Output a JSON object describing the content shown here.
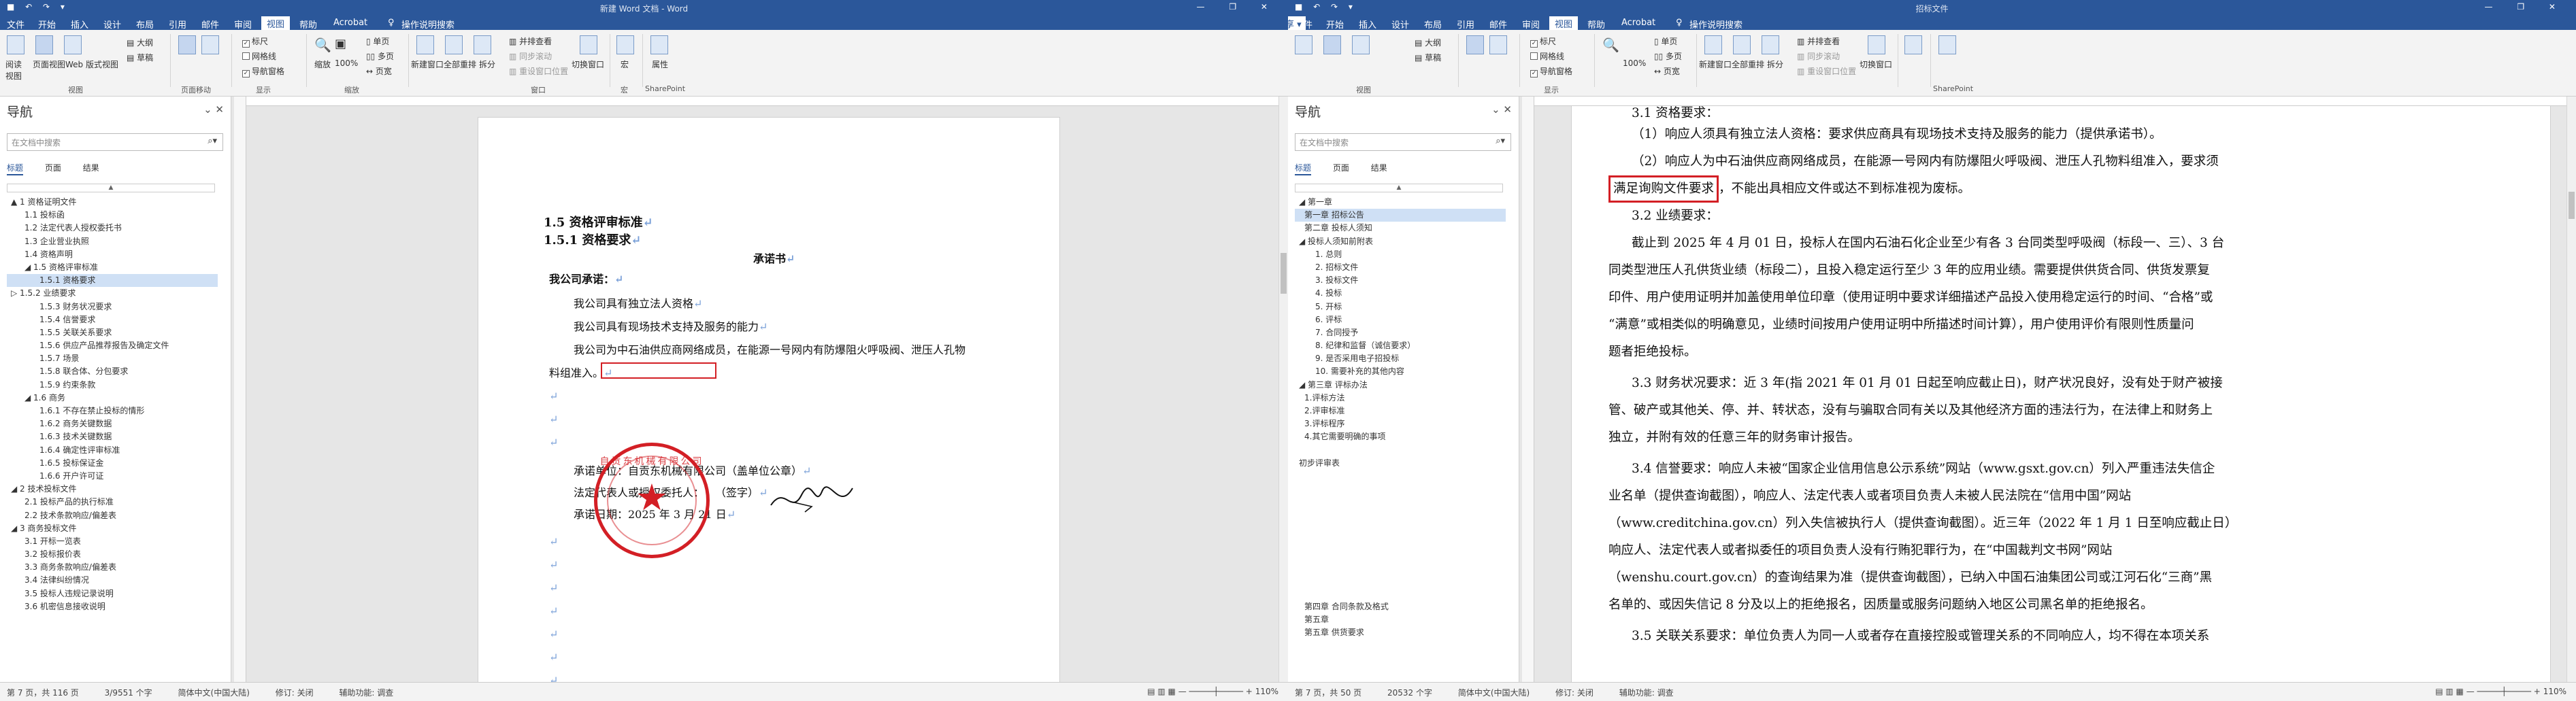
{
  "left": {
    "title": "新建 Word 文档 - Word",
    "tabs": [
      "文件",
      "开始",
      "插入",
      "设计",
      "布局",
      "引用",
      "邮件",
      "审阅",
      "视图",
      "帮助",
      "Acrobat"
    ],
    "active_tab": "视图",
    "tell_me": "操作说明搜索",
    "ribbon": {
      "views_group": [
        "阅读视图",
        "页面视图",
        "Web 版式视图"
      ],
      "outline": [
        "大纲",
        "草稿"
      ],
      "views_label": "视图",
      "page_move": "页面移动",
      "show": [
        "标尺",
        "网格线",
        "导航窗格"
      ],
      "show_label": "显示",
      "zoom_items": [
        "缩放",
        "100%"
      ],
      "pages": [
        "单页",
        "多页",
        "页宽"
      ],
      "zoom_label": "缩放",
      "window": [
        "新建窗口",
        "全部重排",
        "拆分"
      ],
      "window_small": [
        "并排查看",
        "同步滚动",
        "重设窗口位置"
      ],
      "switch": "切换窗口",
      "window_label": "窗口",
      "macro": "宏",
      "macro_label": "宏",
      "props": "属性",
      "sharepoint": "SharePoint"
    },
    "nav": {
      "title": "导航",
      "search_placeholder": "在文档中搜索",
      "tabs": [
        "标题",
        "页面",
        "结果"
      ],
      "items": [
        "▲ 1 资格证明文件",
        "1.1 投标函",
        "1.2 法定代表人授权委托书",
        "1.3 企业营业执照",
        "1.4 资格声明",
        "◢ 1.5 资格评审标准",
        "1.5.1 资格要求",
        "▷ 1.5.2 业绩要求",
        "1.5.3 财务状况要求",
        "1.5.4 信誉要求",
        "1.5.5 关联关系要求",
        "1.5.6 供应产品推荐报告及确定文件",
        "1.5.7 场景",
        "1.5.8 联合体、分包要求",
        "1.5.9 约束条款",
        "◢ 1.6 商务",
        "1.6.1 不存在禁止投标的情形",
        "1.6.2 商务关键数据",
        "1.6.3 技术关键数据",
        "1.6.4 确定性评审标准",
        "1.6.5 投标保证金",
        "1.6.6 开户许可证",
        "◢ 2 技术投标文件",
        "2.1 投标产品的执行标准",
        "2.2 技术条款响应/偏差表",
        "◢ 3 商务投标文件",
        "3.1 开标一览表",
        "3.2 投标报价表",
        "3.3 商务条款响应/偏差表",
        "3.4 法律纠纷情况",
        "3.5 投标人违规记录说明",
        "3.6 机密信息接收说明"
      ],
      "selected": 6
    },
    "doc": {
      "h1": "1.5 资格评审标准",
      "h2": "1.5.1 资格要求",
      "center_title": "承诺书",
      "lines": [
        "我公司承诺：",
        "我公司具有独立法人资格",
        "我公司具有现场技术支持及服务的能力",
        "我公司为中石油供应商网络成员，在能源一号网内有防爆阻火呼吸阀、泄压人孔物",
        "料组准入。"
      ],
      "sign": [
        "承诺单位：自贡东机械有限公司（盖单位公章）",
        "法定代表人或授权委托人：　　（签字）",
        "承诺日期：2025 年 3 月 21 日"
      ],
      "stamp_text": "自贡东机械有限公司"
    },
    "status": [
      "第 7 页，共 116 页",
      "3/9551 个字",
      "简体中文(中国大陆)",
      "修订: 关闭",
      "辅助功能: 调查"
    ],
    "zoom": "110%"
  },
  "right": {
    "title": "招标文件",
    "tabs": [
      "文件",
      "开始",
      "插入",
      "设计",
      "布局",
      "引用",
      "邮件",
      "审阅",
      "视图",
      "帮助",
      "Acrobat"
    ],
    "active_tab": "视图",
    "tell_me": "操作说明搜索",
    "share": "共享",
    "nav": {
      "title": "导航",
      "search_placeholder": "在文档中搜索",
      "tabs": [
        "标题",
        "页面",
        "结果"
      ],
      "items": [
        "◢ 第一章",
        "第一章 招标公告",
        "第二章 投标人须知",
        "◢ 投标人须知前附表",
        "1. 总则",
        "2. 招标文件",
        "3. 投标文件",
        "4. 投标",
        "5. 开标",
        "6. 评标",
        "7. 合同授予",
        "8. 纪律和监督（诚信要求）",
        "9. 是否采用电子招投标",
        "10. 需要补充的其他内容",
        "◢ 第三章 评标办法",
        "1.评标方法",
        "2.评审标准",
        "3.评标程序",
        "4.其它需要明确的事项",
        "",
        "初步评审表",
        "",
        "",
        "",
        "",
        "",
        "",
        "",
        "",
        "",
        "",
        "第四章 合同条款及格式",
        "第五章",
        "第五章 供货要求"
      ],
      "selected": 1
    },
    "doc": {
      "p0": "3.1 资格要求：",
      "p1": "（1）响应人须具有独立法人资格：要求供应商具有现场技术支持及服务的能力（提供承诺书）。",
      "p2a": "（2）响应人为中石油供应商网络成员，在能源一号网内有防爆阻火呼吸阀、泄压人孔物料组准入，要求须",
      "p2b": "满足询购文件要求",
      "p2c": "，不能出具相应文件或达不到标准视为废标。",
      "p3": "3.2 业绩要求：",
      "p4": [
        "截止到 2025 年 4 月 01 日，投标人在国内石油石化企业至少有各 3 台同类型呼吸阀（标段一、三）、3 台",
        "同类型泄压人孔供货业绩（标段二），且投入稳定运行至少 3 年的应用业绩。需要提供供货合同、供货发票复",
        "印件、用户使用证明并加盖使用单位印章（使用证明中要求详细描述产品投入使用稳定运行的时间、“合格”或",
        "“满意”或相类似的明确意见，业绩时间按用户使用证明中所描述时间计算），用户使用评价有限则性质量问",
        "题者拒绝投标。"
      ],
      "p5": [
        "3.3 财务状况要求：近 3 年(指 2021 年 01 月 01 日起至响应截止日)，财产状况良好，没有处于财产被接",
        "管、破产或其他关、停、并、转状态，没有与骗取合同有关以及其他经济方面的违法行为，在法律上和财务上",
        "独立，并附有效的任意三年的财务审计报告。"
      ],
      "p6": [
        "3.4 信誉要求：响应人未被“国家企业信用信息公示系统”网站（www.gsxt.gov.cn）列入严重违法失信企",
        "业名单（提供查询截图），响应人、法定代表人或者项目负责人未被人民法院在“信用中国”网站",
        "（www.creditchina.gov.cn）列入失信被执行人（提供查询截图）。近三年（2022 年 1 月 1 日至响应截止日）",
        "响应人、法定代表人或者拟委任的项目负责人没有行贿犯罪行为，在“中国裁判文书网”网站",
        "（wenshu.court.gov.cn）的查询结果为准（提供查询截图），已纳入中国石油集团公司或江河石化“三商”黑",
        "名单的、或因失信记 8 分及以上的拒绝报名，因质量或服务问题纳入地区公司黑名单的拒绝报名。"
      ],
      "p7": "3.5 关联关系要求：单位负责人为同一人或者存在直接控股或管理关系的不同响应人，均不得在本项关系"
    },
    "status": [
      "第 7 页，共 50 页",
      "20532 个字",
      "简体中文(中国大陆)",
      "修订: 关闭",
      "辅助功能: 调查"
    ],
    "zoom": "110%"
  }
}
